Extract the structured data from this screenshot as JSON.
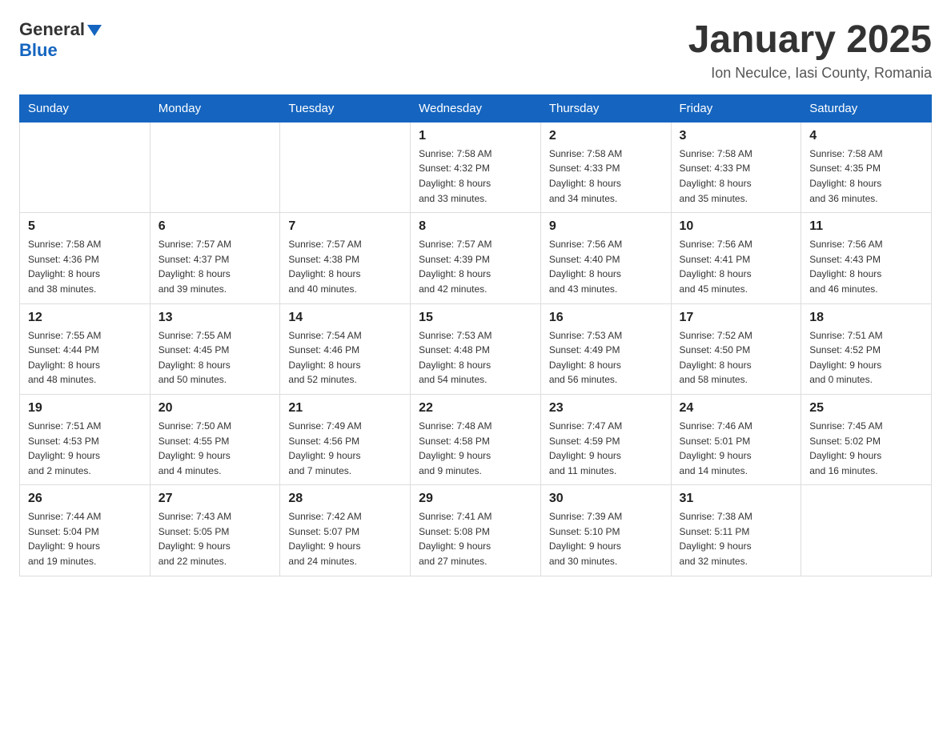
{
  "header": {
    "logo_general": "General",
    "logo_blue": "Blue",
    "title": "January 2025",
    "subtitle": "Ion Neculce, Iasi County, Romania"
  },
  "days_of_week": [
    "Sunday",
    "Monday",
    "Tuesday",
    "Wednesday",
    "Thursday",
    "Friday",
    "Saturday"
  ],
  "weeks": [
    [
      {
        "day": "",
        "info": ""
      },
      {
        "day": "",
        "info": ""
      },
      {
        "day": "",
        "info": ""
      },
      {
        "day": "1",
        "info": "Sunrise: 7:58 AM\nSunset: 4:32 PM\nDaylight: 8 hours\nand 33 minutes."
      },
      {
        "day": "2",
        "info": "Sunrise: 7:58 AM\nSunset: 4:33 PM\nDaylight: 8 hours\nand 34 minutes."
      },
      {
        "day": "3",
        "info": "Sunrise: 7:58 AM\nSunset: 4:33 PM\nDaylight: 8 hours\nand 35 minutes."
      },
      {
        "day": "4",
        "info": "Sunrise: 7:58 AM\nSunset: 4:35 PM\nDaylight: 8 hours\nand 36 minutes."
      }
    ],
    [
      {
        "day": "5",
        "info": "Sunrise: 7:58 AM\nSunset: 4:36 PM\nDaylight: 8 hours\nand 38 minutes."
      },
      {
        "day": "6",
        "info": "Sunrise: 7:57 AM\nSunset: 4:37 PM\nDaylight: 8 hours\nand 39 minutes."
      },
      {
        "day": "7",
        "info": "Sunrise: 7:57 AM\nSunset: 4:38 PM\nDaylight: 8 hours\nand 40 minutes."
      },
      {
        "day": "8",
        "info": "Sunrise: 7:57 AM\nSunset: 4:39 PM\nDaylight: 8 hours\nand 42 minutes."
      },
      {
        "day": "9",
        "info": "Sunrise: 7:56 AM\nSunset: 4:40 PM\nDaylight: 8 hours\nand 43 minutes."
      },
      {
        "day": "10",
        "info": "Sunrise: 7:56 AM\nSunset: 4:41 PM\nDaylight: 8 hours\nand 45 minutes."
      },
      {
        "day": "11",
        "info": "Sunrise: 7:56 AM\nSunset: 4:43 PM\nDaylight: 8 hours\nand 46 minutes."
      }
    ],
    [
      {
        "day": "12",
        "info": "Sunrise: 7:55 AM\nSunset: 4:44 PM\nDaylight: 8 hours\nand 48 minutes."
      },
      {
        "day": "13",
        "info": "Sunrise: 7:55 AM\nSunset: 4:45 PM\nDaylight: 8 hours\nand 50 minutes."
      },
      {
        "day": "14",
        "info": "Sunrise: 7:54 AM\nSunset: 4:46 PM\nDaylight: 8 hours\nand 52 minutes."
      },
      {
        "day": "15",
        "info": "Sunrise: 7:53 AM\nSunset: 4:48 PM\nDaylight: 8 hours\nand 54 minutes."
      },
      {
        "day": "16",
        "info": "Sunrise: 7:53 AM\nSunset: 4:49 PM\nDaylight: 8 hours\nand 56 minutes."
      },
      {
        "day": "17",
        "info": "Sunrise: 7:52 AM\nSunset: 4:50 PM\nDaylight: 8 hours\nand 58 minutes."
      },
      {
        "day": "18",
        "info": "Sunrise: 7:51 AM\nSunset: 4:52 PM\nDaylight: 9 hours\nand 0 minutes."
      }
    ],
    [
      {
        "day": "19",
        "info": "Sunrise: 7:51 AM\nSunset: 4:53 PM\nDaylight: 9 hours\nand 2 minutes."
      },
      {
        "day": "20",
        "info": "Sunrise: 7:50 AM\nSunset: 4:55 PM\nDaylight: 9 hours\nand 4 minutes."
      },
      {
        "day": "21",
        "info": "Sunrise: 7:49 AM\nSunset: 4:56 PM\nDaylight: 9 hours\nand 7 minutes."
      },
      {
        "day": "22",
        "info": "Sunrise: 7:48 AM\nSunset: 4:58 PM\nDaylight: 9 hours\nand 9 minutes."
      },
      {
        "day": "23",
        "info": "Sunrise: 7:47 AM\nSunset: 4:59 PM\nDaylight: 9 hours\nand 11 minutes."
      },
      {
        "day": "24",
        "info": "Sunrise: 7:46 AM\nSunset: 5:01 PM\nDaylight: 9 hours\nand 14 minutes."
      },
      {
        "day": "25",
        "info": "Sunrise: 7:45 AM\nSunset: 5:02 PM\nDaylight: 9 hours\nand 16 minutes."
      }
    ],
    [
      {
        "day": "26",
        "info": "Sunrise: 7:44 AM\nSunset: 5:04 PM\nDaylight: 9 hours\nand 19 minutes."
      },
      {
        "day": "27",
        "info": "Sunrise: 7:43 AM\nSunset: 5:05 PM\nDaylight: 9 hours\nand 22 minutes."
      },
      {
        "day": "28",
        "info": "Sunrise: 7:42 AM\nSunset: 5:07 PM\nDaylight: 9 hours\nand 24 minutes."
      },
      {
        "day": "29",
        "info": "Sunrise: 7:41 AM\nSunset: 5:08 PM\nDaylight: 9 hours\nand 27 minutes."
      },
      {
        "day": "30",
        "info": "Sunrise: 7:39 AM\nSunset: 5:10 PM\nDaylight: 9 hours\nand 30 minutes."
      },
      {
        "day": "31",
        "info": "Sunrise: 7:38 AM\nSunset: 5:11 PM\nDaylight: 9 hours\nand 32 minutes."
      },
      {
        "day": "",
        "info": ""
      }
    ]
  ]
}
